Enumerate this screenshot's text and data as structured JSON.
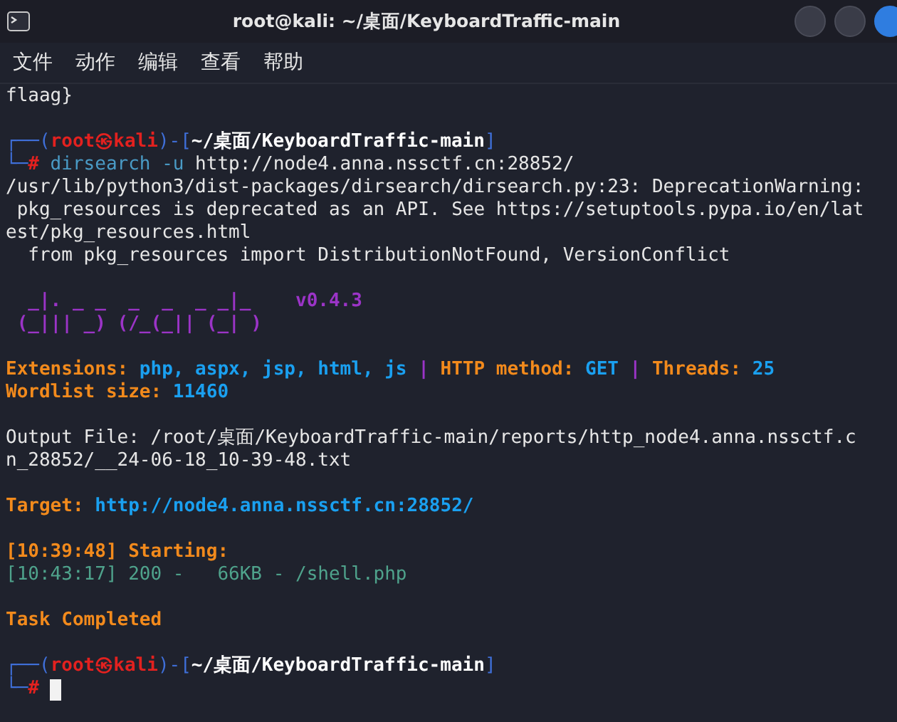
{
  "window": {
    "title": "root@kali: ~/桌面/KeyboardTraffic-main"
  },
  "menu": [
    "文件",
    "动作",
    "编辑",
    "查看",
    "帮助"
  ],
  "terminal": {
    "lines": [
      {
        "kind": "text",
        "segments": [
          {
            "text": "flaag}",
            "kind": "plain"
          }
        ]
      },
      {
        "kind": "blank"
      },
      {
        "kind": "text",
        "segments": [
          {
            "text": "┌──(",
            "kind": "frame"
          },
          {
            "text": "root㉿kali",
            "kind": "user"
          },
          {
            "text": ")-[",
            "kind": "frame"
          },
          {
            "text": "~/桌面/KeyboardTraffic-main",
            "kind": "path"
          },
          {
            "text": "]",
            "kind": "frame"
          }
        ]
      },
      {
        "kind": "text",
        "segments": [
          {
            "text": "└─",
            "kind": "frame"
          },
          {
            "text": "#",
            "kind": "hash"
          },
          {
            "text": " dirsearch -u",
            "kind": "cmd"
          },
          {
            "text": " http://node4.anna.nssctf.cn:28852/",
            "kind": "plain"
          }
        ]
      },
      {
        "kind": "text",
        "segments": [
          {
            "text": "/usr/lib/python3/dist-packages/dirsearch/dirsearch.py:23: DeprecationWarning:",
            "kind": "plain"
          }
        ]
      },
      {
        "kind": "text",
        "segments": [
          {
            "text": " pkg_resources is deprecated as an API. See https://setuptools.pypa.io/en/lat",
            "kind": "plain"
          }
        ]
      },
      {
        "kind": "text",
        "segments": [
          {
            "text": "est/pkg_resources.html",
            "kind": "plain"
          }
        ]
      },
      {
        "kind": "text",
        "segments": [
          {
            "text": "  from pkg_resources import DistributionNotFound, VersionConflict",
            "kind": "plain"
          }
        ]
      },
      {
        "kind": "blank"
      },
      {
        "kind": "text",
        "segments": [
          {
            "text": "  _|. _ _  _  _  _ _|_    v0.4.3",
            "kind": "banner"
          }
        ]
      },
      {
        "kind": "text",
        "segments": [
          {
            "text": " (_||| _) (/_(_|| (_| )",
            "kind": "banner"
          }
        ]
      },
      {
        "kind": "blank"
      },
      {
        "kind": "text",
        "segments": [
          {
            "text": "Extensions: ",
            "kind": "label"
          },
          {
            "text": "php, aspx, jsp, html, js",
            "kind": "value"
          },
          {
            "text": " | ",
            "kind": "sep"
          },
          {
            "text": "HTTP method: ",
            "kind": "label"
          },
          {
            "text": "GET",
            "kind": "value"
          },
          {
            "text": " | ",
            "kind": "sep"
          },
          {
            "text": "Threads: ",
            "kind": "label"
          },
          {
            "text": "25",
            "kind": "value"
          }
        ]
      },
      {
        "kind": "text",
        "segments": [
          {
            "text": "Wordlist size: ",
            "kind": "label"
          },
          {
            "text": "11460",
            "kind": "value"
          }
        ]
      },
      {
        "kind": "blank"
      },
      {
        "kind": "text",
        "segments": [
          {
            "text": "Output File: /root/桌面/KeyboardTraffic-main/reports/http_node4.anna.nssctf.c",
            "kind": "plain"
          }
        ]
      },
      {
        "kind": "text",
        "segments": [
          {
            "text": "n_28852/__24-06-18_10-39-48.txt",
            "kind": "plain"
          }
        ]
      },
      {
        "kind": "blank"
      },
      {
        "kind": "text",
        "segments": [
          {
            "text": "Target: ",
            "kind": "label"
          },
          {
            "text": "http://node4.anna.nssctf.cn:28852/",
            "kind": "value"
          }
        ]
      },
      {
        "kind": "blank"
      },
      {
        "kind": "text",
        "segments": [
          {
            "text": "[10:39:48] Starting:",
            "kind": "label"
          }
        ]
      },
      {
        "kind": "text",
        "segments": [
          {
            "text": "[10:43:17] 200 -   66KB - /shell.php",
            "kind": "log"
          }
        ]
      },
      {
        "kind": "blank"
      },
      {
        "kind": "text",
        "segments": [
          {
            "text": "Task Completed",
            "kind": "label"
          }
        ]
      },
      {
        "kind": "blank"
      },
      {
        "kind": "text",
        "segments": [
          {
            "text": "┌──(",
            "kind": "frame"
          },
          {
            "text": "root㉿kali",
            "kind": "user"
          },
          {
            "text": ")-[",
            "kind": "frame"
          },
          {
            "text": "~/桌面/KeyboardTraffic-main",
            "kind": "path"
          },
          {
            "text": "]",
            "kind": "frame"
          }
        ]
      },
      {
        "kind": "text",
        "segments": [
          {
            "text": "└─",
            "kind": "frame"
          },
          {
            "text": "#",
            "kind": "hash"
          }
        ],
        "cursor": true
      }
    ]
  }
}
